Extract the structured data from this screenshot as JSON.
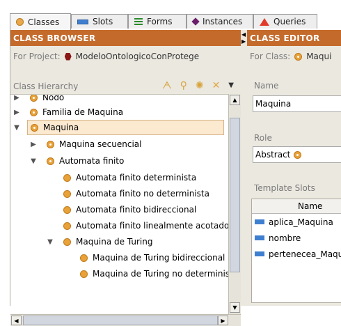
{
  "tabs": [
    {
      "label": "Classes",
      "icon": "class-icon",
      "active": true
    },
    {
      "label": "Slots",
      "icon": "slot-icon",
      "active": false
    },
    {
      "label": "Forms",
      "icon": "forms-icon",
      "active": false
    },
    {
      "label": "Instances",
      "icon": "instance-icon",
      "active": false
    },
    {
      "label": "Queries",
      "icon": "query-icon",
      "active": false
    }
  ],
  "browser": {
    "title": "CLASS BROWSER",
    "project_label": "For Project:",
    "project_name": "ModeloOntologicoConProtege",
    "hierarchy_label": "Class Hierarchy",
    "tree": [
      {
        "label": "Nodo",
        "toggle": "▶",
        "kind": "class"
      },
      {
        "label": "Familia de Maquina",
        "toggle": "▶",
        "kind": "class"
      },
      {
        "label": "Maquina",
        "toggle": "▼",
        "kind": "class",
        "selected": true
      },
      {
        "label": "Maquina secuencial",
        "toggle": "▶",
        "kind": "class"
      },
      {
        "label": "Automata finito",
        "toggle": "▼",
        "kind": "class"
      },
      {
        "label": "Automata finito determinista",
        "toggle": "",
        "kind": "leaf"
      },
      {
        "label": "Automata finito no determinista",
        "toggle": "",
        "kind": "leaf"
      },
      {
        "label": "Automata finito bidireccional",
        "toggle": "",
        "kind": "leaf"
      },
      {
        "label": "Automata finito linealmente acotado",
        "toggle": "",
        "kind": "leaf"
      },
      {
        "label": "Maquina de Turing",
        "toggle": "▼",
        "kind": "leaf"
      },
      {
        "label": "Maquina de Turing bidireccional",
        "toggle": "",
        "kind": "leaf"
      },
      {
        "label": "Maquina de Turing no determinist",
        "toggle": "",
        "kind": "leaf"
      }
    ]
  },
  "editor": {
    "title": "CLASS EDITOR",
    "for_class_label": "For Class:",
    "for_class_value": "Maqui",
    "name_label": "Name",
    "name_value": "Maquina",
    "role_label": "Role",
    "role_value": "Abstract",
    "template_slots_label": "Template Slots",
    "slots_column": "Name",
    "slots": [
      "aplica_Maquina",
      "nombre",
      "pertenecea_Maqui"
    ]
  },
  "colors": {
    "header": "#c46b2c",
    "class_icon": "#e9a23a",
    "slot_icon": "#3f7fd0",
    "selection": "#fbe9d0"
  }
}
